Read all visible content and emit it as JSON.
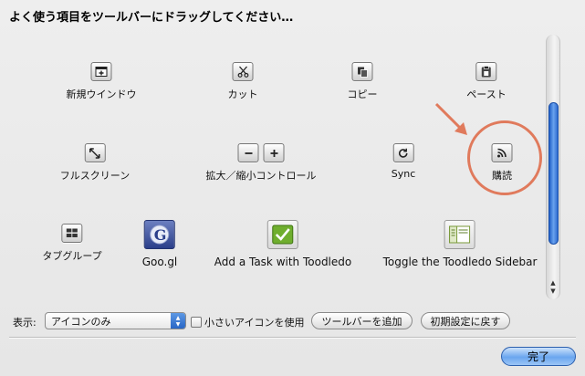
{
  "dialog": {
    "heading": "よく使う項目をツールバーにドラッグしてください…"
  },
  "palette": {
    "items": [
      {
        "id": "new-window",
        "label": "新規ウインドウ",
        "icon": "new-window-icon"
      },
      {
        "id": "cut",
        "label": "カット",
        "icon": "scissors-icon"
      },
      {
        "id": "copy",
        "label": "コピー",
        "icon": "copy-icon"
      },
      {
        "id": "paste",
        "label": "ペースト",
        "icon": "clipboard-icon"
      },
      {
        "id": "fullscreen",
        "label": "フルスクリーン",
        "icon": "fullscreen-icon"
      },
      {
        "id": "zoom",
        "label": "拡大／縮小コントロール",
        "icon": "zoom-controls-icon"
      },
      {
        "id": "sync",
        "label": "Sync",
        "icon": "sync-icon"
      },
      {
        "id": "subscribe",
        "label": "購読",
        "icon": "rss-icon"
      },
      {
        "id": "tab-groups",
        "label": "タブグループ",
        "icon": "tab-groups-icon"
      },
      {
        "id": "googl",
        "label": "Goo.gl",
        "icon": "google-icon"
      },
      {
        "id": "toodledo-task",
        "label": "Add a Task with Toodledo",
        "icon": "checkmark-icon"
      },
      {
        "id": "toodledo-sidebar",
        "label": "Toggle the Toodledo Sidebar",
        "icon": "sidebar-icon"
      }
    ]
  },
  "bottom": {
    "show_label": "表示:",
    "show_value": "アイコンのみ",
    "small_icons_label": "小さいアイコンを使用",
    "small_icons_checked": false,
    "add_toolbar_label": "ツールバーを追加",
    "restore_default_label": "初期設定に戻す",
    "done_label": "完了"
  },
  "colors": {
    "annotation": "#e07a5c",
    "accent": "#3a7ad8"
  }
}
